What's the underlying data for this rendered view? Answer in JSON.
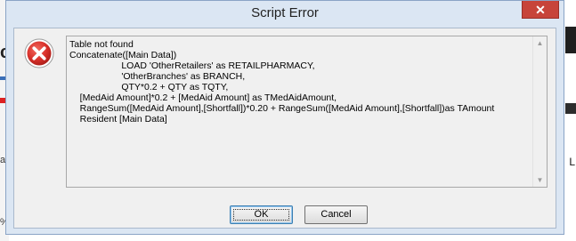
{
  "dialog": {
    "title": "Script Error",
    "close_glyph": "✕",
    "icon": "error-icon",
    "message_lines": [
      "Table not found",
      "Concatenate([Main Data])",
      "                    LOAD 'OtherRetailers' as RETAILPHARMACY,",
      "                    'OtherBranches' as BRANCH,",
      "                    QTY*0.2 + QTY as TQTY,",
      "    [MedAid Amount]*0.2 + [MedAid Amount] as TMedAidAmount,",
      "    RangeSum([MedAid Amount],[Shortfall])*0.20 + RangeSum([MedAid Amount],[Shortfall])as TAmount",
      "    Resident [Main Data]"
    ],
    "ok_label": "OK",
    "cancel_label": "Cancel"
  },
  "background": {
    "left_fragment_a": "c",
    "left_fragment_b": "a",
    "left_fragment_c": "%",
    "right_fragment": "L"
  },
  "colors": {
    "title_bar": "#dbe6f3",
    "close_button": "#c7443a",
    "error_red": "#d8302a"
  }
}
